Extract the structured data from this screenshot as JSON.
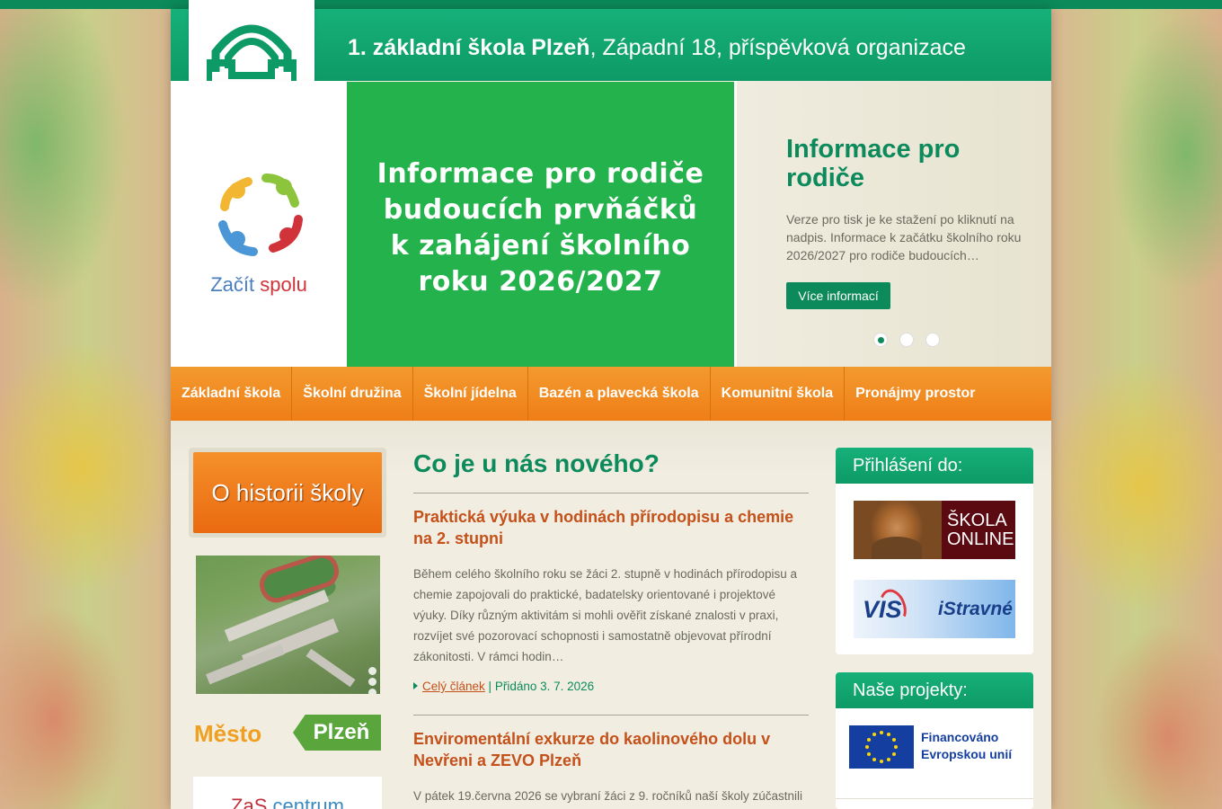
{
  "header": {
    "title_bold": "1. základní škola Plzeň",
    "title_rest": ", Západní 18, příspěvková organizace"
  },
  "left_banner": {
    "text_start": "Začít",
    "text_end": "spolu"
  },
  "slider": {
    "slide_lines": [
      "Informace pro rodiče",
      "budoucích prvňáčků",
      "k zahájení školního",
      "roku 2026/2027"
    ],
    "panel_title": "Informace pro rodiče",
    "panel_text": "Verze pro tisk je ke stažení po kliknutí na nadpis. Informace k začátku školního roku 2026/2027 pro rodiče budoucích…",
    "button_label": "Více informací",
    "active_slide": 1,
    "slide_count": 3
  },
  "nav": {
    "items": [
      "Základní škola",
      "Školní družina",
      "Školní jídelna",
      "Bazén a plavecká škola",
      "Komunitní škola",
      "Pronájmy prostor"
    ]
  },
  "left_col": {
    "history_label": "O historii školy",
    "plzen_left": "Město",
    "plzen_right": "Plzeň",
    "zas_start": "ZaS",
    "zas_end": "centrum"
  },
  "main": {
    "heading": "Co je u nás nového?",
    "articles": [
      {
        "title": "Praktická výuka v hodinách přírodopisu a chemie na 2. stupni",
        "text": "Během celého školního roku se žáci 2. stupně v hodinách přírodopisu a chemie zapojovali do praktické, badatelsky orientované i projektové výuky. Díky různým aktivitám si mohli ověřit získané znalosti v praxi, rozvíjet své pozorovací schopnosti i samostatně objevovat přírodní zákonitosti. V rámci hodin…",
        "link": "Celý článek",
        "separator": "|",
        "date": "Přidáno 3. 7. 2026"
      },
      {
        "title": "Enviromentální exkurze do kaolinového dolu v Nevřeni a ZEVO Plzeň",
        "text": "V pátek 19.června 2026 se vybraní žáci z 9. ročníků naší školy zúčastnili"
      }
    ]
  },
  "sidebar": {
    "login_heading": "Přihlášení do:",
    "skola_online_line1": "ŠKOLA",
    "skola_online_line2": "ONLINE",
    "vis_logo": "VIS",
    "istravne": "iStravné",
    "projects_heading": "Naše projekty:",
    "eu_line1": "Financováno",
    "eu_line2": "Evropskou unií"
  },
  "colors": {
    "brand_green": "#0d8a5c",
    "nav_orange": "#f07e17",
    "article_title": "#c4501a"
  }
}
